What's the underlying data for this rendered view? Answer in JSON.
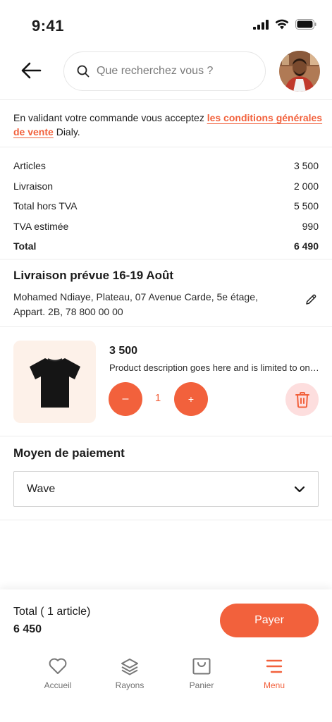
{
  "status": {
    "time": "9:41"
  },
  "search": {
    "placeholder": "Que recherchez vous ?"
  },
  "terms": {
    "prefix": "En validant votre commande vous acceptez ",
    "link": "les conditions générales de vente",
    "suffix": " Dialy."
  },
  "summary": {
    "rows": [
      {
        "label": "Articles",
        "value": "3 500"
      },
      {
        "label": "Livraison",
        "value": "2 000"
      },
      {
        "label": "Total hors TVA",
        "value": "5 500"
      },
      {
        "label": "TVA estimée",
        "value": "990"
      }
    ],
    "total_label": "Total",
    "total_value": "6 490"
  },
  "delivery": {
    "title": "Livraison prévue 16-19 Août",
    "address": "Mohamed Ndiaye, Plateau, 07 Avenue Carde, 5e étage, Appart. 2B, 78 800 00 00"
  },
  "product": {
    "price": "3 500",
    "description": "Product description goes here and is limited to one line",
    "quantity": "1",
    "minus": "–",
    "plus": "+"
  },
  "payment": {
    "title": "Moyen de paiement",
    "selected": "Wave"
  },
  "checkout": {
    "total_label": "Total ( 1 article)",
    "total_value": "6 450",
    "pay_label": "Payer"
  },
  "tabs": [
    {
      "label": "Accueil",
      "icon": "heart-icon"
    },
    {
      "label": "Rayons",
      "icon": "layers-icon"
    },
    {
      "label": "Panier",
      "icon": "bag-icon"
    },
    {
      "label": "Menu",
      "icon": "menu-icon"
    }
  ],
  "colors": {
    "accent": "#f2613c",
    "accent_light": "#fddede",
    "product_bg": "#fdf1e9"
  }
}
